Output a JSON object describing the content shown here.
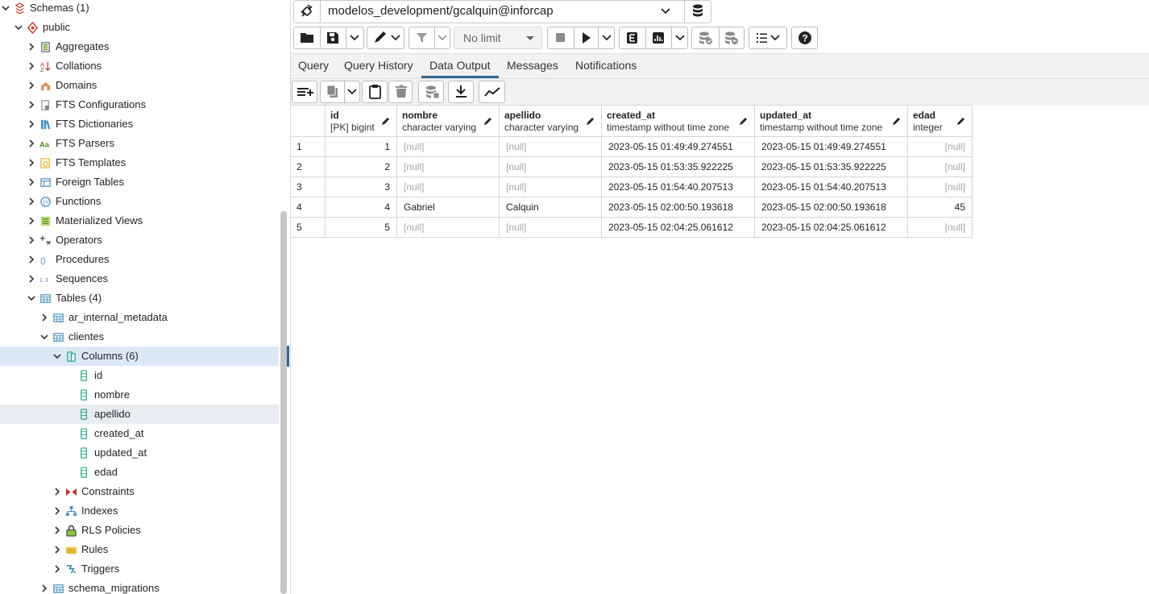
{
  "tree": {
    "items": [
      {
        "label": "Schemas (1)",
        "level": 0,
        "expanded": true,
        "icon": "schemas-icon"
      },
      {
        "label": "public",
        "level": 1,
        "expanded": true,
        "icon": "schema-icon"
      },
      {
        "label": "Aggregates",
        "level": 2,
        "expanded": false,
        "icon": "aggregates-icon"
      },
      {
        "label": "Collations",
        "level": 2,
        "expanded": false,
        "icon": "collations-icon"
      },
      {
        "label": "Domains",
        "level": 2,
        "expanded": false,
        "icon": "domains-icon"
      },
      {
        "label": "FTS Configurations",
        "level": 2,
        "expanded": false,
        "icon": "fts-configurations-icon"
      },
      {
        "label": "FTS Dictionaries",
        "level": 2,
        "expanded": false,
        "icon": "fts-dictionaries-icon"
      },
      {
        "label": "FTS Parsers",
        "level": 2,
        "expanded": false,
        "icon": "fts-parsers-icon"
      },
      {
        "label": "FTS Templates",
        "level": 2,
        "expanded": false,
        "icon": "fts-templates-icon"
      },
      {
        "label": "Foreign Tables",
        "level": 2,
        "expanded": false,
        "icon": "foreign-tables-icon"
      },
      {
        "label": "Functions",
        "level": 2,
        "expanded": false,
        "icon": "functions-icon"
      },
      {
        "label": "Materialized Views",
        "level": 2,
        "expanded": false,
        "icon": "materialized-views-icon"
      },
      {
        "label": "Operators",
        "level": 2,
        "expanded": false,
        "icon": "operators-icon"
      },
      {
        "label": "Procedures",
        "level": 2,
        "expanded": false,
        "icon": "procedures-icon"
      },
      {
        "label": "Sequences",
        "level": 2,
        "expanded": false,
        "icon": "sequences-icon"
      },
      {
        "label": "Tables (4)",
        "level": 2,
        "expanded": true,
        "icon": "tables-icon"
      },
      {
        "label": "ar_internal_metadata",
        "level": 3,
        "expanded": false,
        "icon": "table-icon"
      },
      {
        "label": "clientes",
        "level": 3,
        "expanded": true,
        "icon": "table-icon"
      },
      {
        "label": "Columns (6)",
        "level": 4,
        "expanded": true,
        "icon": "columns-icon",
        "selected": true
      },
      {
        "label": "id",
        "level": 5,
        "leaf": true,
        "icon": "column-icon"
      },
      {
        "label": "nombre",
        "level": 5,
        "leaf": true,
        "icon": "column-icon"
      },
      {
        "label": "apellido",
        "level": 5,
        "leaf": true,
        "icon": "column-icon",
        "hover": true
      },
      {
        "label": "created_at",
        "level": 5,
        "leaf": true,
        "icon": "column-icon"
      },
      {
        "label": "updated_at",
        "level": 5,
        "leaf": true,
        "icon": "column-icon"
      },
      {
        "label": "edad",
        "level": 5,
        "leaf": true,
        "icon": "column-icon"
      },
      {
        "label": "Constraints",
        "level": 4,
        "expanded": false,
        "icon": "constraints-icon"
      },
      {
        "label": "Indexes",
        "level": 4,
        "expanded": false,
        "icon": "indexes-icon"
      },
      {
        "label": "RLS Policies",
        "level": 4,
        "expanded": false,
        "icon": "rls-policies-icon"
      },
      {
        "label": "Rules",
        "level": 4,
        "expanded": false,
        "icon": "rules-icon"
      },
      {
        "label": "Triggers",
        "level": 4,
        "expanded": false,
        "icon": "triggers-icon"
      },
      {
        "label": "schema_migrations",
        "level": 3,
        "expanded": false,
        "icon": "table-icon"
      }
    ]
  },
  "connection": {
    "label": "modelos_development/gcalquin@inforcap"
  },
  "toolbar": {
    "limit_label": "No limit"
  },
  "tabs": [
    "Query",
    "Query History",
    "Data Output",
    "Messages",
    "Notifications"
  ],
  "active_tab": "Data Output",
  "grid": {
    "columns": [
      {
        "name": "id",
        "type": "[PK] bigint"
      },
      {
        "name": "nombre",
        "type": "character varying"
      },
      {
        "name": "apellido",
        "type": "character varying"
      },
      {
        "name": "created_at",
        "type": "timestamp without time zone"
      },
      {
        "name": "updated_at",
        "type": "timestamp without time zone"
      },
      {
        "name": "edad",
        "type": "integer"
      }
    ],
    "rows": [
      {
        "n": "1",
        "id": "1",
        "nombre": "[null]",
        "apellido": "[null]",
        "created_at": "2023-05-15 01:49:49.274551",
        "updated_at": "2023-05-15 01:49:49.274551",
        "edad": "[null]"
      },
      {
        "n": "2",
        "id": "2",
        "nombre": "[null]",
        "apellido": "[null]",
        "created_at": "2023-05-15 01:53:35.922225",
        "updated_at": "2023-05-15 01:53:35.922225",
        "edad": "[null]"
      },
      {
        "n": "3",
        "id": "3",
        "nombre": "[null]",
        "apellido": "[null]",
        "created_at": "2023-05-15 01:54:40.207513",
        "updated_at": "2023-05-15 01:54:40.207513",
        "edad": "[null]"
      },
      {
        "n": "4",
        "id": "4",
        "nombre": "Gabriel",
        "apellido": "Calquin",
        "created_at": "2023-05-15 02:00:50.193618",
        "updated_at": "2023-05-15 02:00:50.193618",
        "edad": "45"
      },
      {
        "n": "5",
        "id": "5",
        "nombre": "[null]",
        "apellido": "[null]",
        "created_at": "2023-05-15 02:04:25.061612",
        "updated_at": "2023-05-15 02:04:25.061612",
        "edad": "[null]"
      }
    ]
  },
  "colors": {
    "accent": "#326690",
    "selected_row": "#dbe9f7",
    "panel_bg": "#f2f2f2",
    "null_text": "#a6a6a6"
  }
}
